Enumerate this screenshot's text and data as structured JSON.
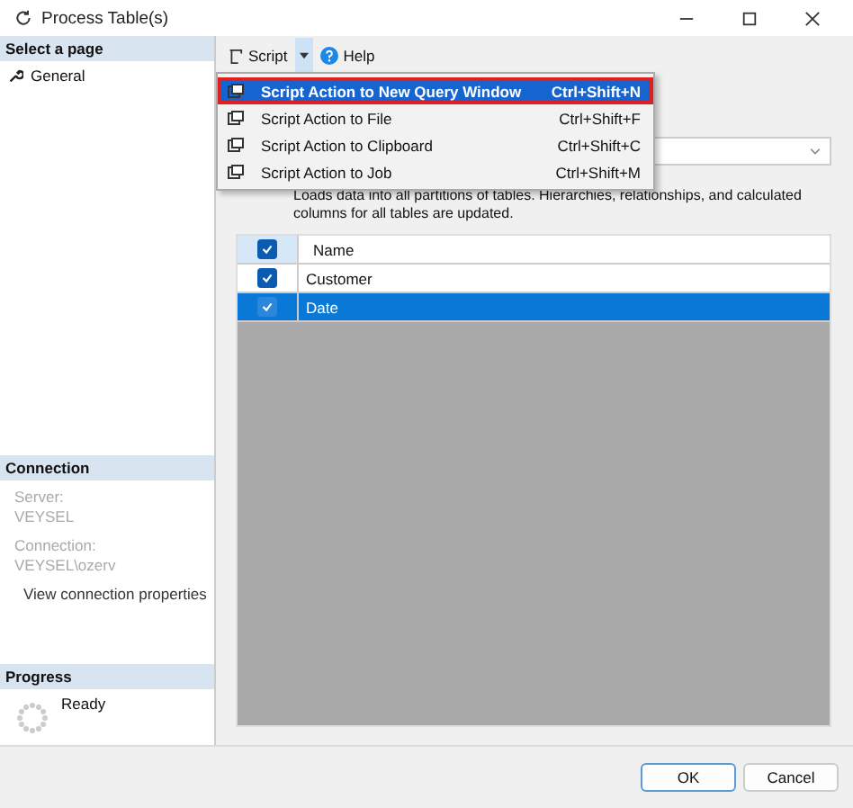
{
  "window": {
    "title": "Process Table(s)"
  },
  "sidebar": {
    "heading": "Select a page",
    "items": [
      {
        "label": "General"
      }
    ]
  },
  "connection": {
    "heading": "Connection",
    "fields": [
      {
        "label": "Server:",
        "value": "VEYSEL"
      },
      {
        "label": "Connection:",
        "value": "VEYSEL\\ozerv"
      }
    ],
    "link": "View connection properties"
  },
  "progress": {
    "heading": "Progress",
    "status": "Ready"
  },
  "toolbar": {
    "script": "Script",
    "help": "Help"
  },
  "script_menu": [
    {
      "label": "Script Action to New Query Window",
      "shortcut": "Ctrl+Shift+N",
      "selected": true
    },
    {
      "label": "Script Action to File",
      "shortcut": "Ctrl+Shift+F",
      "selected": false
    },
    {
      "label": "Script Action to Clipboard",
      "shortcut": "Ctrl+Shift+C",
      "selected": false
    },
    {
      "label": "Script Action to Job",
      "shortcut": "Ctrl+Shift+M",
      "selected": false
    }
  ],
  "description": "Loads data into all partitions of tables. Hierarchies, relationships, and calculated columns for all tables are updated.",
  "table": {
    "header_checked": true,
    "columns": [
      "Name"
    ],
    "rows": [
      {
        "name": "Customer",
        "checked": true,
        "selected": false
      },
      {
        "name": "Date",
        "checked": true,
        "selected": true
      }
    ]
  },
  "buttons": [
    "OK",
    "Cancel"
  ]
}
